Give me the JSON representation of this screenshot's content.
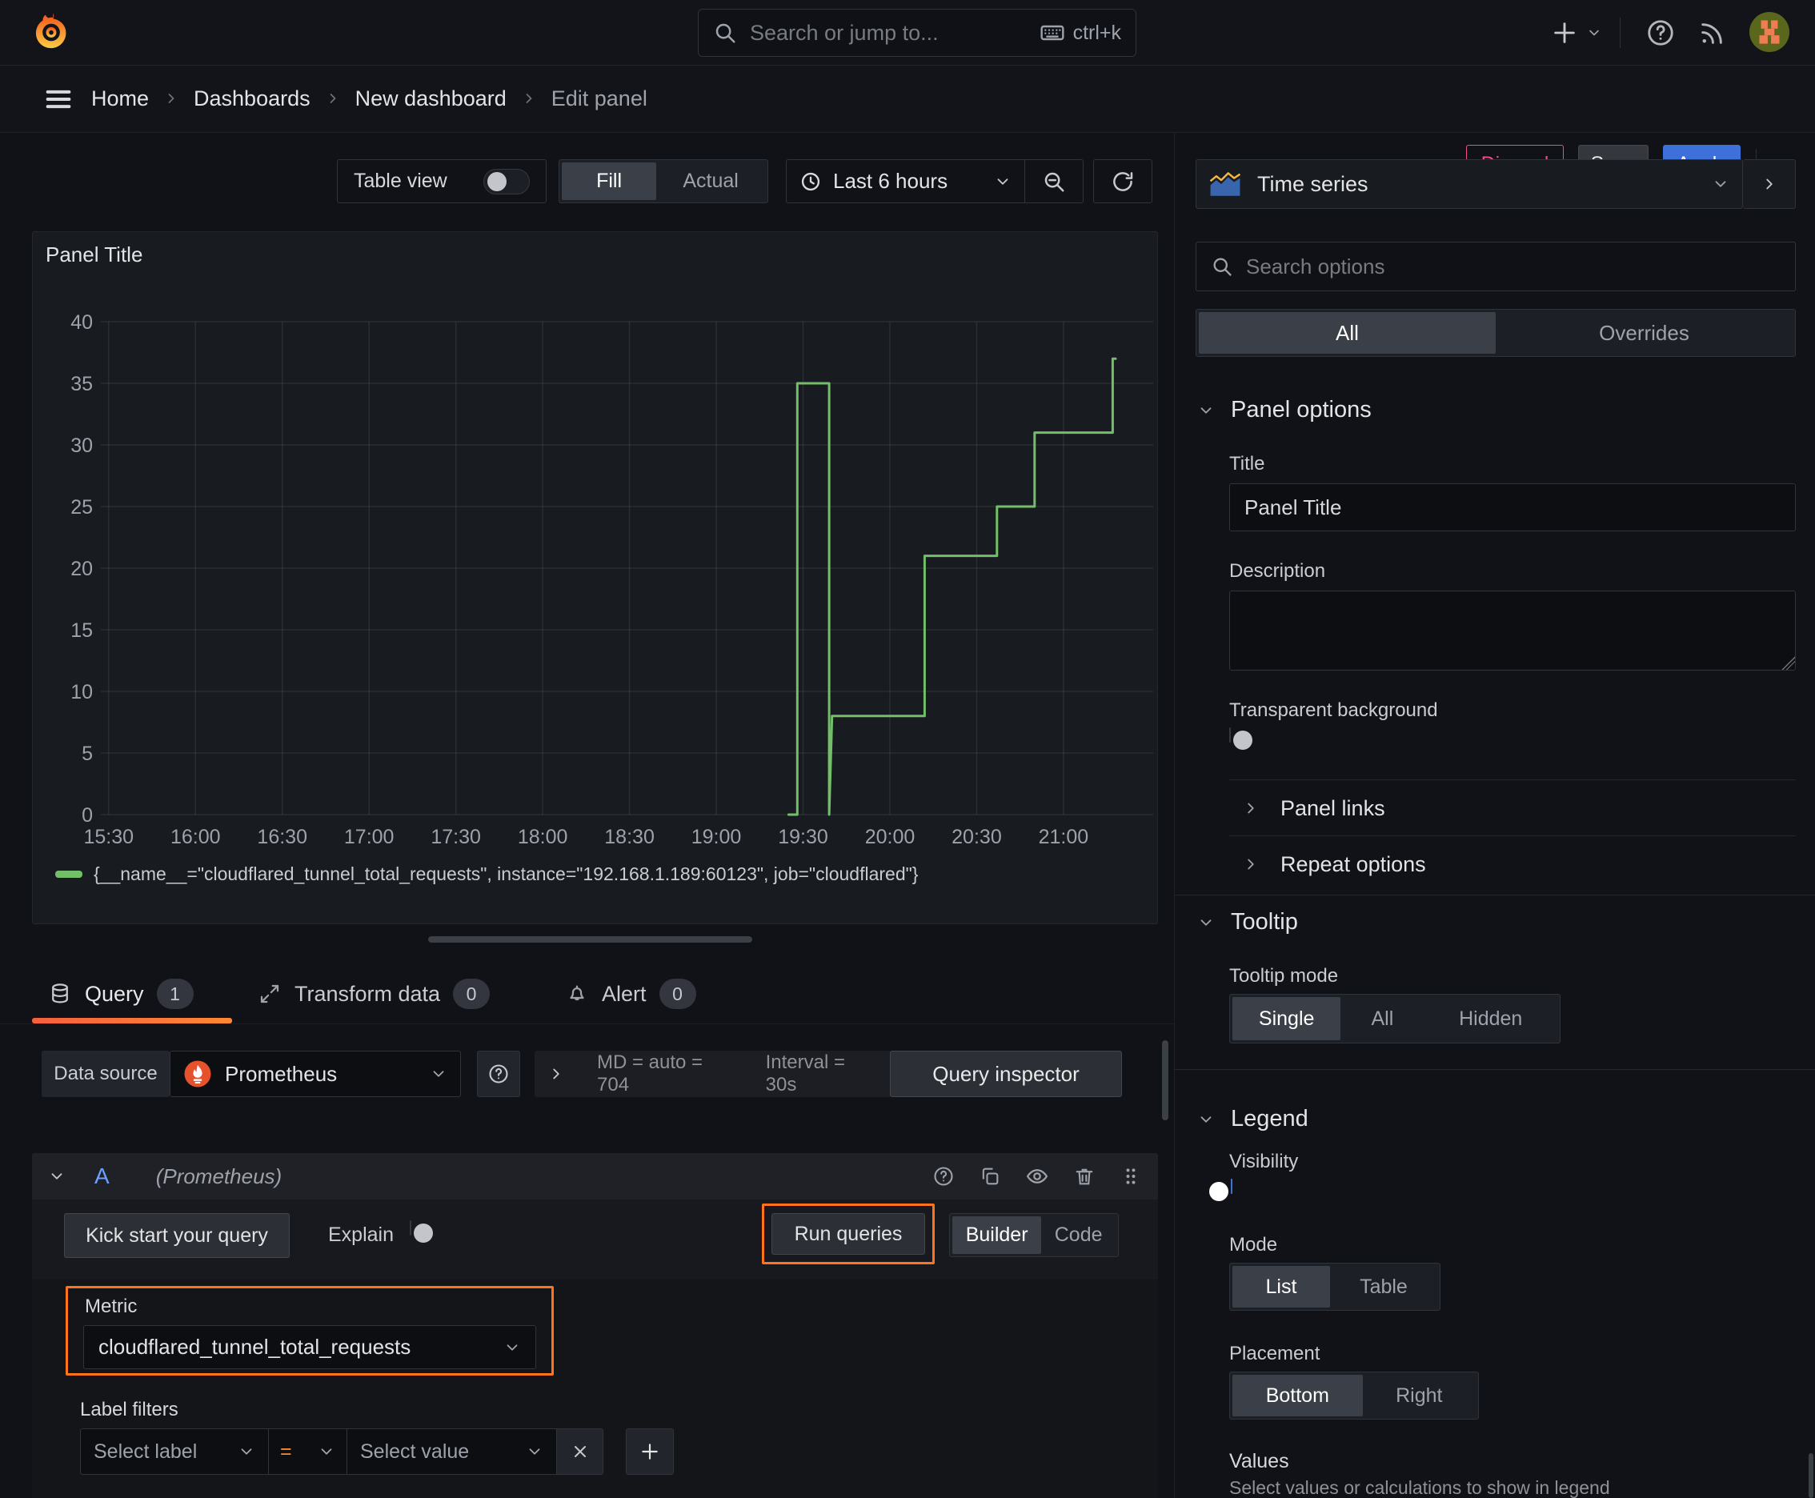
{
  "topbar": {
    "search_placeholder": "Search or jump to...",
    "shortcut": "ctrl+k"
  },
  "breadcrumb": {
    "items": [
      "Home",
      "Dashboards",
      "New dashboard"
    ],
    "current": "Edit panel"
  },
  "actions": {
    "discard": "Discard",
    "save": "Save",
    "apply": "Apply"
  },
  "toolbar": {
    "table_view": "Table view",
    "fill": "Fill",
    "actual": "Actual",
    "time_range": "Last 6 hours"
  },
  "panel": {
    "title": "Panel Title"
  },
  "chart_data": {
    "type": "line",
    "line_interpolation": "step-after",
    "title": "Panel Title",
    "x_ticks": [
      "15:30",
      "16:00",
      "16:30",
      "17:00",
      "17:30",
      "18:00",
      "18:30",
      "19:00",
      "19:30",
      "20:00",
      "20:30",
      "21:00"
    ],
    "x_domain": [
      "15:19",
      "21:31"
    ],
    "y_ticks": [
      0,
      5,
      10,
      15,
      20,
      25,
      30,
      35,
      40
    ],
    "ylim": [
      0,
      40
    ],
    "grid": true,
    "legend_position": "bottom",
    "series": [
      {
        "name": "{__name__=\"cloudflared_tunnel_total_requests\", instance=\"192.168.1.189:60123\", job=\"cloudflared\"}",
        "color": "#73bf69",
        "points": [
          [
            "19:25",
            0
          ],
          [
            "19:28",
            0
          ],
          [
            "19:28",
            35
          ],
          [
            "19:39",
            35
          ],
          [
            "19:39",
            0
          ],
          [
            "19:40",
            8
          ],
          [
            "20:12",
            8
          ],
          [
            "20:12",
            21
          ],
          [
            "20:37",
            21
          ],
          [
            "20:37",
            25
          ],
          [
            "20:50",
            25
          ],
          [
            "20:50",
            31
          ],
          [
            "21:17",
            31
          ],
          [
            "21:17",
            37
          ],
          [
            "21:18",
            37
          ]
        ]
      }
    ]
  },
  "tabs": {
    "items": [
      {
        "label": "Query",
        "count": "1"
      },
      {
        "label": "Transform data",
        "count": "0"
      },
      {
        "label": "Alert",
        "count": "0"
      }
    ]
  },
  "datasource": {
    "label": "Data source",
    "name": "Prometheus",
    "stats_md": "MD = auto = 704",
    "stats_interval": "Interval = 30s",
    "inspector": "Query inspector"
  },
  "query": {
    "ref": "A",
    "ds_hint": "(Prometheus)",
    "kick": "Kick start your query",
    "explain": "Explain",
    "run": "Run queries",
    "builder": "Builder",
    "code": "Code",
    "metric_label": "Metric",
    "metric": "cloudflared_tunnel_total_requests",
    "label_filters": "Label filters",
    "select_label": "Select label",
    "op": "=",
    "select_value": "Select value"
  },
  "sidebar": {
    "visualization": "Time series",
    "search_placeholder": "Search options",
    "tab_all": "All",
    "tab_overrides": "Overrides",
    "panel_options": {
      "title": "Panel options",
      "title_label": "Title",
      "title_value": "Panel Title",
      "description_label": "Description",
      "transparent_label": "Transparent background",
      "panel_links": "Panel links",
      "repeat_options": "Repeat options"
    },
    "tooltip": {
      "title": "Tooltip",
      "mode_label": "Tooltip mode",
      "options": [
        "Single",
        "All",
        "Hidden"
      ]
    },
    "legend": {
      "title": "Legend",
      "visibility_label": "Visibility",
      "mode_label": "Mode",
      "mode_options": [
        "List",
        "Table"
      ],
      "placement_label": "Placement",
      "placement_options": [
        "Bottom",
        "Right"
      ],
      "values_label": "Values",
      "values_help": "Select values or calculations to show in legend"
    }
  },
  "colors": {
    "accent_orange": "#ff731d",
    "series_green": "#73bf69",
    "apply_blue": "#3d71d9",
    "discard_pink": "#ef4d8a",
    "tab_underline_from": "#f55f3e",
    "tab_underline_to": "#ff8833"
  }
}
